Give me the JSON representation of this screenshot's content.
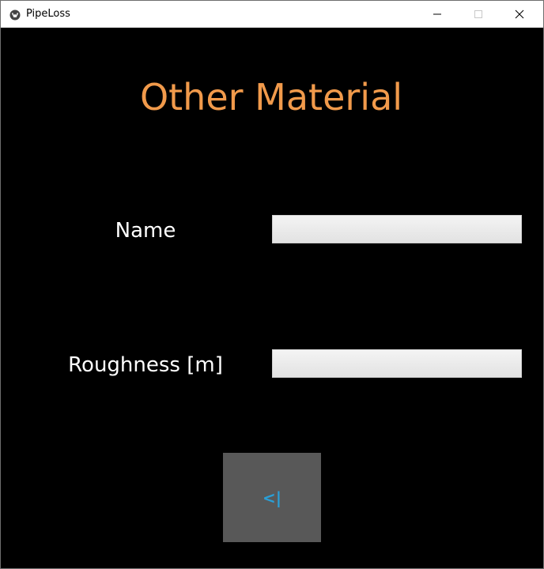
{
  "window": {
    "title": "PipeLoss",
    "icon": "kivy-logo-icon",
    "controls": [
      "minimize-icon",
      "maximize-icon",
      "close-icon"
    ]
  },
  "screen": {
    "heading": "Other Material",
    "heading_color": "#f19a4b",
    "background_color": "#000000"
  },
  "form": {
    "name_label": "Name",
    "name_value": "",
    "roughness_label": "Roughness [m]",
    "roughness_value": ""
  },
  "back_button": {
    "label": "<|",
    "background_color": "#585858",
    "text_color": "#2a9fd6"
  }
}
